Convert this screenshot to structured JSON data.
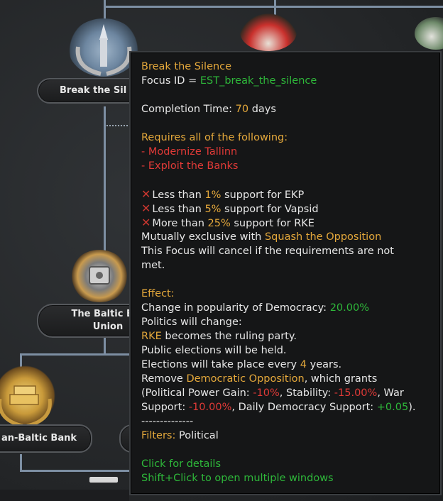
{
  "tree": {
    "focus_top_left": "Break the Sil",
    "focus_mid_left": "The Baltic Eco\nUnion",
    "focus_bottom_left": "an-Baltic Bank"
  },
  "tooltip": {
    "title": "Break the Silence",
    "focus_id_label": "Focus ID = ",
    "focus_id_value": "EST_break_the_silence",
    "completion_label": "Completion Time: ",
    "completion_value": "70",
    "completion_unit": " days",
    "requires_header": "Requires all of the following:",
    "req1": "- Modernize Tallinn",
    "req2": "- Exploit the Banks",
    "cond1": {
      "pre": "Less than ",
      "val": "1%",
      "post": " support for EKP"
    },
    "cond2": {
      "pre": "Less than ",
      "val": "5%",
      "post": " support for Vapsid"
    },
    "cond3": {
      "pre": "More than ",
      "val": "25%",
      "post": " support for RKE"
    },
    "cross_glyph": "✕",
    "mutex_pre": "Mutually exclusive with ",
    "mutex_val": "Squash the Opposition",
    "cancel1": "This Focus will cancel if the requirements are not",
    "cancel2": "met.",
    "effect_header": "Effect:",
    "eff_pop_pre": "Change in popularity of Democracy: ",
    "eff_pop_val": "20.00%",
    "eff_politics": "Politics will change:",
    "eff_rke": "RKE",
    "eff_rke_post": " becomes the ruling party.",
    "eff_public": "Public elections will be held.",
    "eff_elect_pre": "Elections will take place every ",
    "eff_elect_val": "4",
    "eff_elect_post": " years.",
    "eff_remove_pre": "Remove ",
    "eff_remove_val": "Democratic Opposition",
    "eff_remove_post": ", which grants",
    "eff_pp_pre": "(Political Power Gain: ",
    "eff_pp_val": "-10%",
    "eff_stab_pre": ", Stability: ",
    "eff_stab_val": "-15.00%",
    "eff_war_pre": ", War",
    "eff_support_pre": "Support: ",
    "eff_support_val": "-10.00%",
    "eff_daily_pre": ", Daily Democracy Support: ",
    "eff_daily_val": "+0.05",
    "eff_daily_post": ").",
    "separator": "--------------",
    "filters_label": "Filters:",
    "filters_value": " Political",
    "click_details": "Click for details",
    "shift_click": "Shift+Click to open multiple windows"
  },
  "colors": {
    "gold": "#e4a83b",
    "green": "#2eb83a",
    "red": "#e03a37",
    "text": "#e6e6e6"
  }
}
